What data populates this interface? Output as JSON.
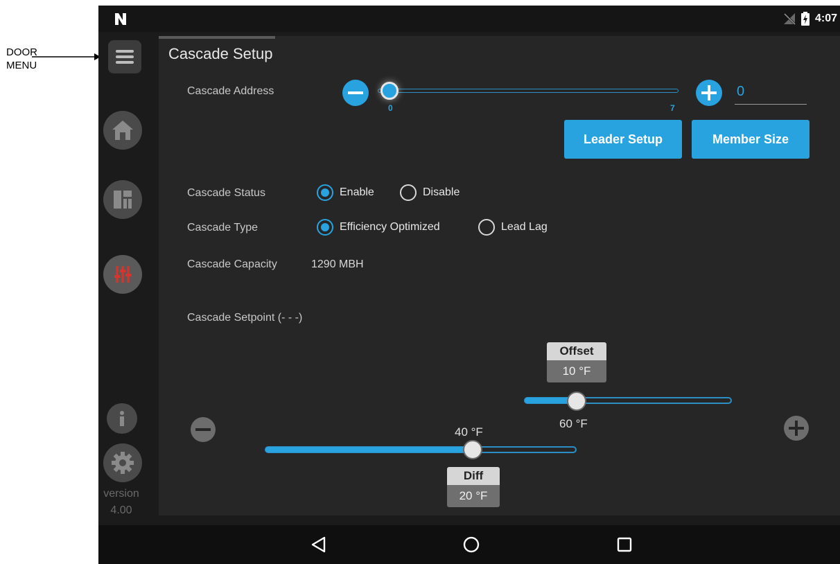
{
  "callout": {
    "line1": "DOOR",
    "line2": "MENU"
  },
  "status_bar": {
    "time": "4:07",
    "logo_icon": "n-logo-icon",
    "signal_icon": "no-signal-icon",
    "battery_icon": "battery-charging-icon"
  },
  "sidebar": {
    "items": [
      {
        "name": "menu",
        "icon": "hamburger-icon"
      },
      {
        "name": "home",
        "icon": "home-icon"
      },
      {
        "name": "dashboard",
        "icon": "dashboard-icon"
      },
      {
        "name": "settings-sliders",
        "icon": "sliders-icon"
      },
      {
        "name": "info",
        "icon": "info-icon"
      },
      {
        "name": "gear",
        "icon": "gear-icon"
      }
    ],
    "version_label": "version",
    "version_number": "4.00"
  },
  "panel": {
    "title": "Cascade Setup",
    "cascade_address": {
      "label": "Cascade Address",
      "value": "0",
      "min": "0",
      "max": "7",
      "slider_value": 0
    },
    "buttons": {
      "leader_setup": "Leader Setup",
      "member_size": "Member Size"
    },
    "cascade_status": {
      "label": "Cascade Status",
      "options": [
        "Enable",
        "Disable"
      ],
      "selected": "Enable"
    },
    "cascade_type": {
      "label": "Cascade Type",
      "options": [
        "Efficiency Optimized",
        "Lead Lag"
      ],
      "selected": "Efficiency Optimized"
    },
    "cascade_capacity": {
      "label": "Cascade Capacity",
      "value": "1290 MBH"
    },
    "cascade_setpoint": {
      "label": "Cascade Setpoint (- - -)",
      "offset": {
        "title": "Offset",
        "value": "10 °F",
        "slider_value_label": "60 °F",
        "fill_fraction": 0.24
      },
      "diff": {
        "title": "Diff",
        "value": "20 °F",
        "slider_value_label": "40 °F",
        "fill_fraction": 0.66
      }
    }
  },
  "navbar": {
    "back_icon": "back-triangle-icon",
    "home_icon": "home-circle-icon",
    "recents_icon": "recents-square-icon"
  },
  "colors": {
    "accent": "#29a3e0",
    "panel": "#262626",
    "background": "#1b1b1b",
    "alert_icon": "#d9342b"
  }
}
